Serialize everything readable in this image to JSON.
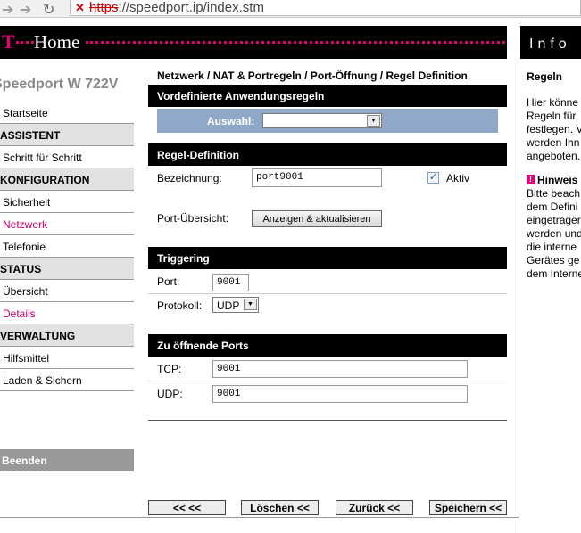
{
  "browser": {
    "url_protocol": "https",
    "url_rest": "://speedport.ip/index.stm"
  },
  "header": {
    "logo_t": "T",
    "logo_home": "Home"
  },
  "info": {
    "title": "Info",
    "heading": "Regeln",
    "text": "Hier könne\nRegeln für\nfestlegen. V\nwerden Ihn\nangeboten.",
    "hint_title": "Hinweis",
    "hint_text": "Bitte beach\ndem Defini\neingetrager\nwerden und\ndie interne\nGerätes ge\ndem Interne"
  },
  "sidebar": {
    "device": "Speedport W 722V",
    "items": [
      {
        "label": "Startseite"
      },
      {
        "label": "ASSISTENT"
      },
      {
        "label": "Schritt für Schritt"
      },
      {
        "label": "KONFIGURATION"
      },
      {
        "label": "Sicherheit"
      },
      {
        "label": "Netzwerk"
      },
      {
        "label": "Telefonie"
      },
      {
        "label": "STATUS"
      },
      {
        "label": "Übersicht"
      },
      {
        "label": "Details"
      },
      {
        "label": "VERWALTUNG"
      },
      {
        "label": "Hilfsmittel"
      },
      {
        "label": "Laden & Sichern"
      }
    ],
    "logout": "Beenden"
  },
  "main": {
    "breadcrumb": "Netzwerk / NAT & Portregeln / Port-Öffnung / Regel Definition",
    "predefined": {
      "title": "Vordefinierte Anwendungsregeln",
      "select_label": "Auswahl:",
      "select_value": ""
    },
    "rule": {
      "title": "Regel-Definition",
      "name_label": "Bezeichnung:",
      "name_value": "port9001",
      "active_label": "Aktiv",
      "active_checked": true,
      "overview_label": "Port-Übersicht:",
      "overview_button": "Anzeigen & aktualisieren"
    },
    "triggering": {
      "title": "Triggering",
      "port_label": "Port:",
      "port_value": "9001",
      "protocol_label": "Protokoll:",
      "protocol_value": "UDP"
    },
    "open_ports": {
      "title": "Zu öffnende Ports",
      "tcp_label": "TCP:",
      "tcp_value": "9001",
      "udp_label": "UDP:",
      "udp_value": "9001"
    },
    "footer": {
      "back_back": "<<  <<",
      "delete": "Löschen <<",
      "back": "Zurück <<",
      "save": "Speichern <<"
    }
  }
}
